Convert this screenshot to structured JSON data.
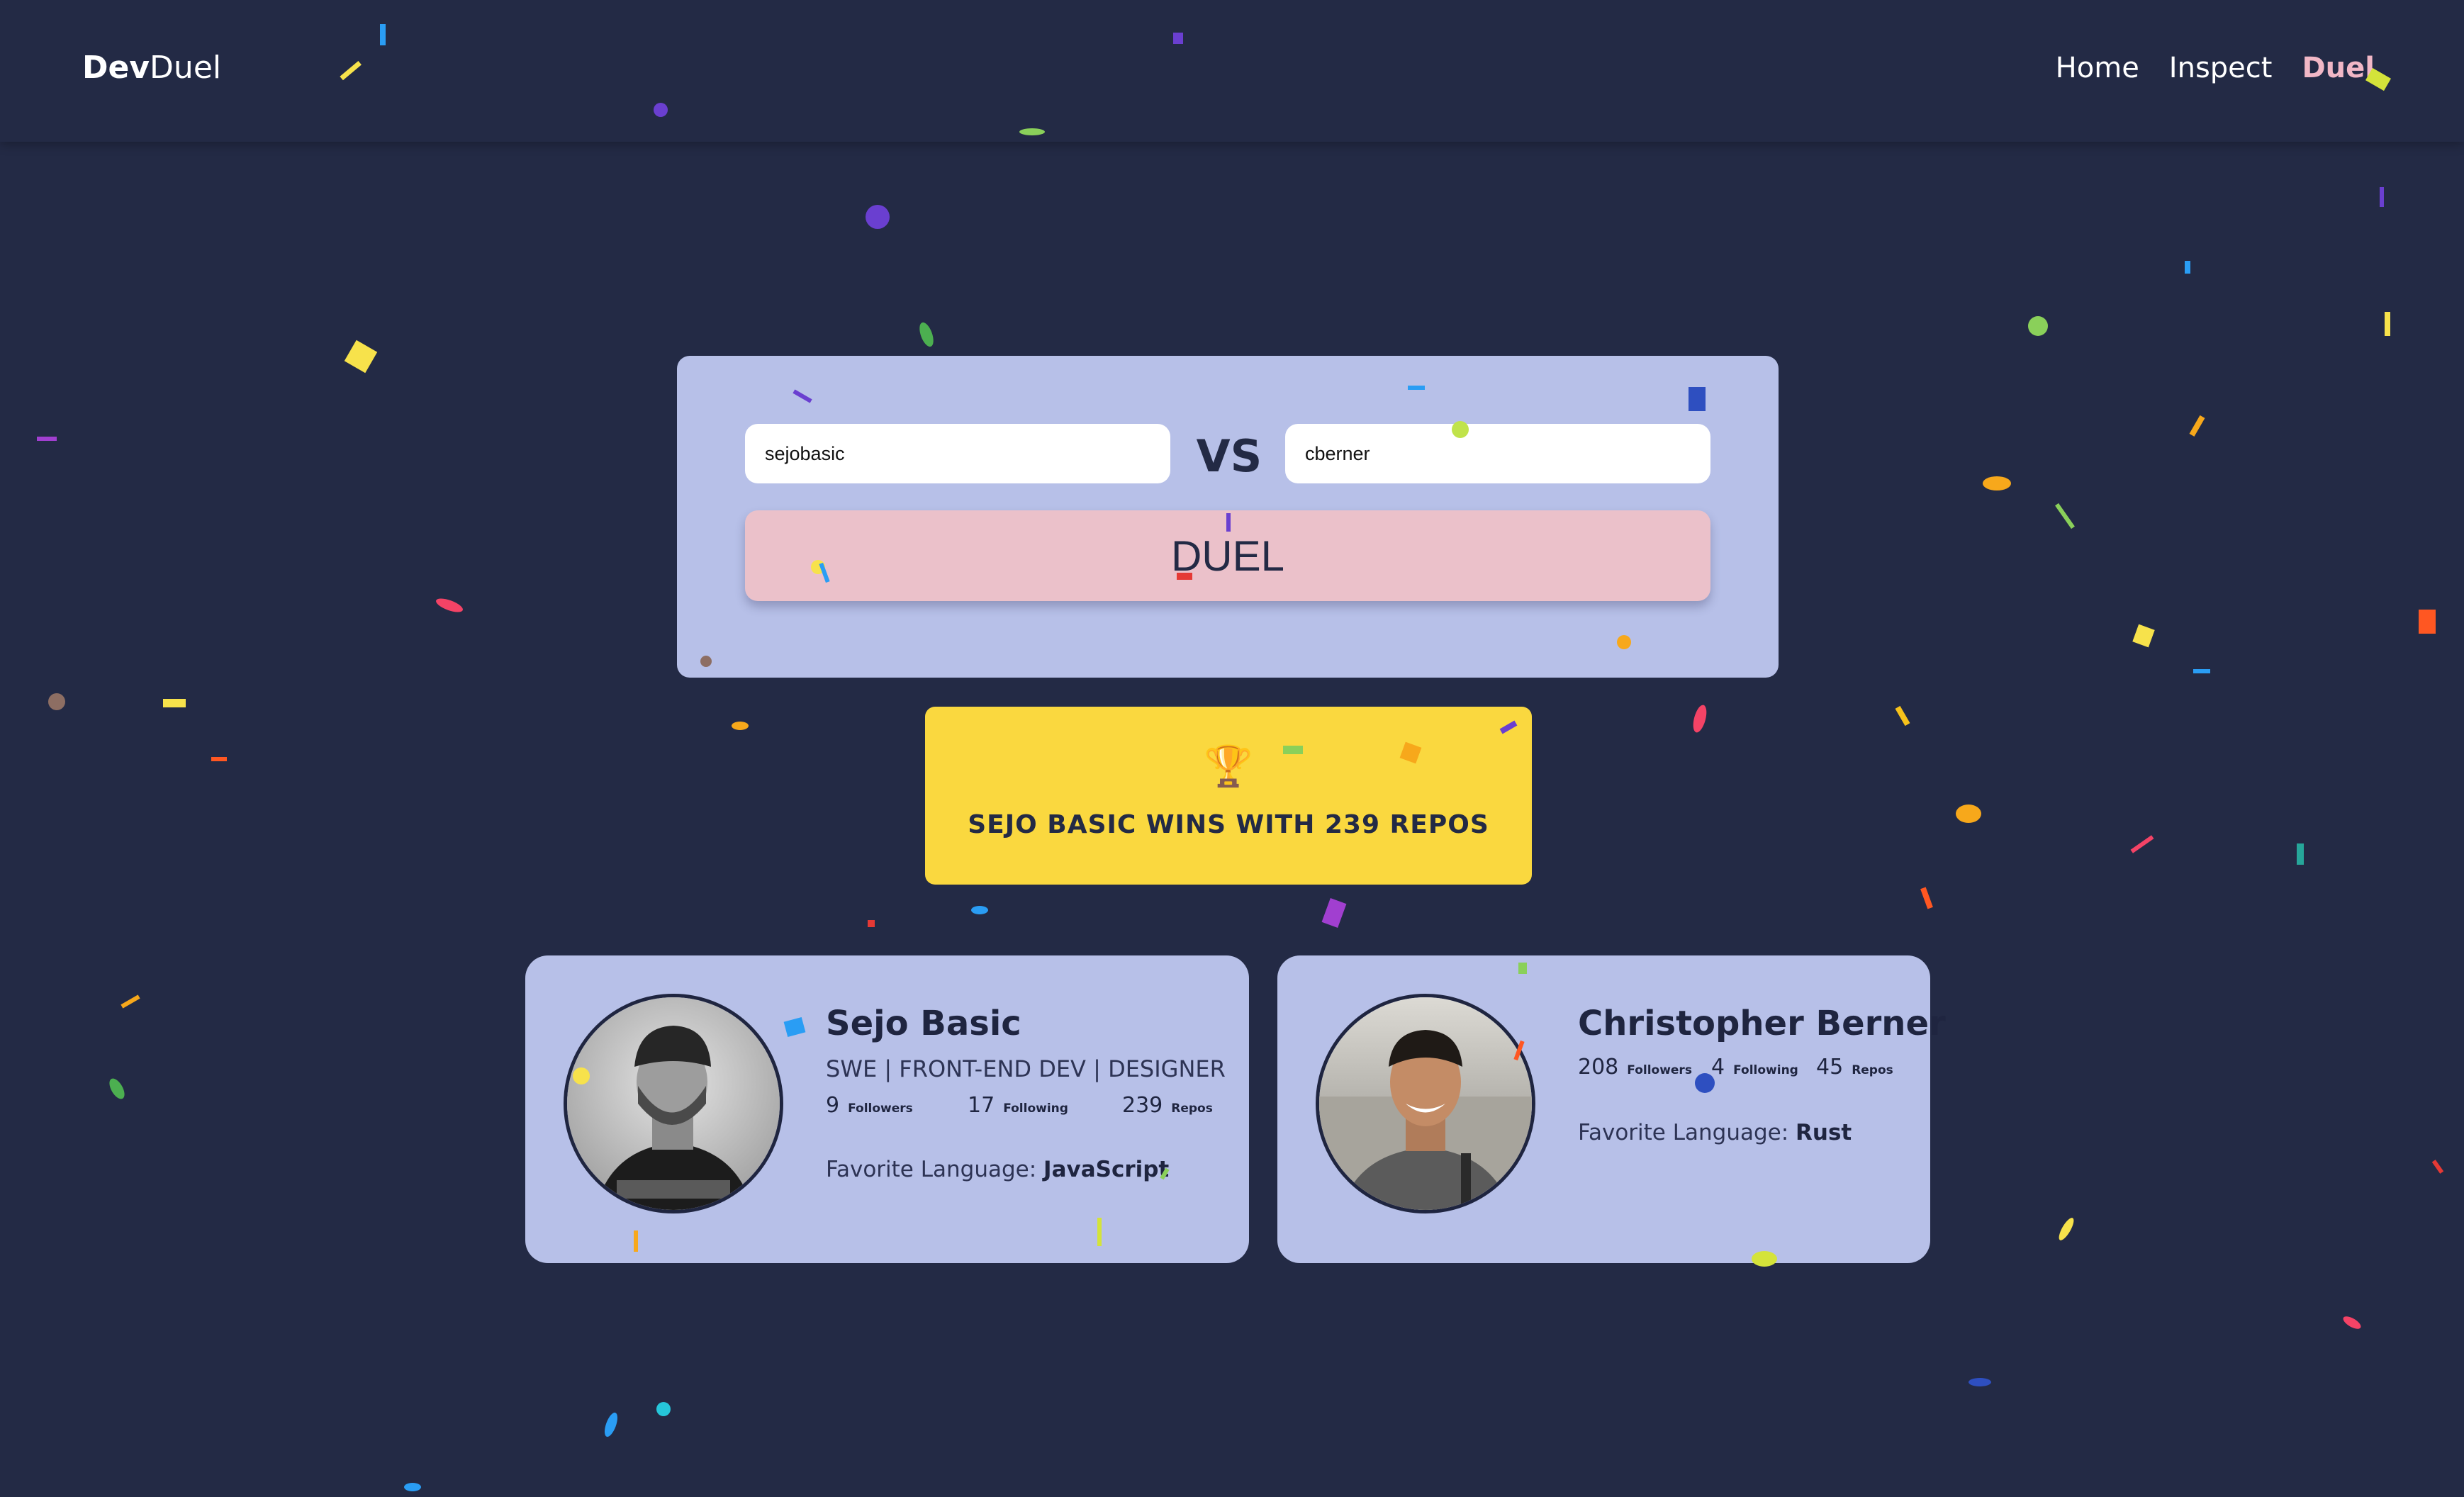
{
  "nav": {
    "logo_bold": "Dev",
    "logo_light": "Duel",
    "links": [
      "Home",
      "Inspect",
      "Duel"
    ],
    "active": "Duel"
  },
  "duel": {
    "user1": "sejobasic",
    "vs": "VS",
    "user2": "cberner",
    "button": "DUEL"
  },
  "result": {
    "trophy": "🏆",
    "text": "SEJO BASIC WINS WITH 239 REPOS"
  },
  "cards": [
    {
      "name": "Sejo Basic",
      "bio": "SWE | FRONT-END DEV | DESIGNER",
      "followers": "9",
      "following": "17",
      "repos": "239",
      "fav_label": "Favorite Language:",
      "fav_value": "JavaScript"
    },
    {
      "name": "Christopher Berner",
      "followers": "208",
      "following": "4",
      "repos": "45",
      "fav_label": "Favorite Language:",
      "fav_value": "Rust"
    }
  ],
  "labels": {
    "followers": "Followers",
    "following": "Following",
    "repos": "Repos"
  },
  "colors": {
    "background": "#232a45",
    "panel": "#b7c0e8",
    "duel_button": "#ebc1ca",
    "winner": "#fad83f",
    "active_nav": "#f1b7c6"
  }
}
